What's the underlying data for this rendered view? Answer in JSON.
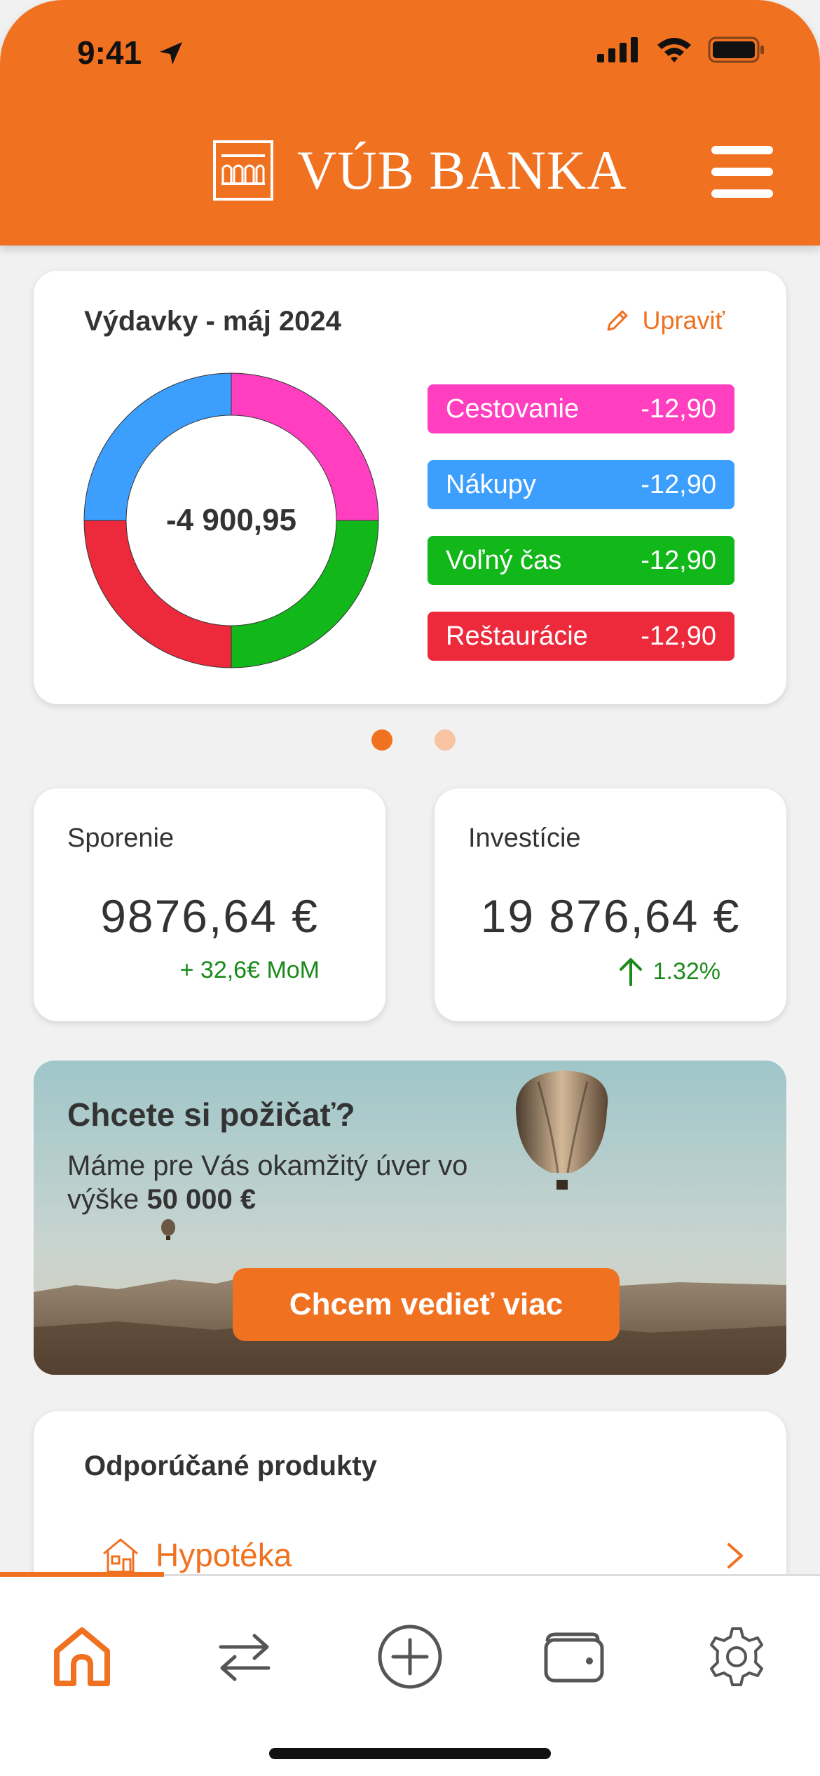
{
  "status_bar": {
    "time": "9:41"
  },
  "header": {
    "brand": "VÚB BANKA"
  },
  "spending": {
    "title": "Výdavky - máj 2024",
    "edit_label": "Upraviť",
    "total": "-4 900,95",
    "categories": [
      {
        "name": "Cestovanie",
        "amount": "-12,90",
        "color": "#ff3fc0"
      },
      {
        "name": "Nákupy",
        "amount": "-12,90",
        "color": "#3c9ffd"
      },
      {
        "name": "Voľný čas",
        "amount": "-12,90",
        "color": "#12b81a"
      },
      {
        "name": "Reštaurácie",
        "amount": "-12,90",
        "color": "#ec2a3c"
      }
    ]
  },
  "pager": {
    "active_color": "#f07120",
    "inactive_color": "#f8c4a2"
  },
  "savings": {
    "title": "Sporenie",
    "value": "9876,64 €",
    "change": "+ 32,6€ MoM"
  },
  "investments": {
    "title": "Investície",
    "value": "19 876,64 €",
    "change": "1.32%"
  },
  "promo": {
    "title": "Chcete si požičať?",
    "text_prefix": "Máme pre Vás okamžitý úver vo výške ",
    "amount": "50 000 €",
    "button": "Chcem vedieť viac"
  },
  "products": {
    "title": "Odporúčané produkty",
    "items": [
      {
        "label": "Hypotéka",
        "icon": "house-icon"
      }
    ]
  },
  "tabbar": {
    "tabs": [
      "home-icon",
      "transfer-icon",
      "add-icon",
      "wallet-icon",
      "settings-icon"
    ],
    "active_color": "#f07120"
  },
  "colors": {
    "brand": "#f07120",
    "positive": "#1b8a1b"
  }
}
